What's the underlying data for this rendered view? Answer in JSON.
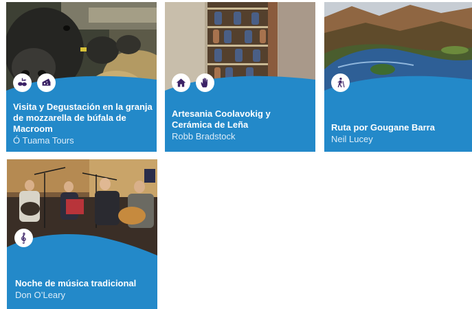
{
  "cards": [
    {
      "title": "Visita y Degustación en la granja de mozzarella de búfala de Macroom",
      "author": "Ó Tuama Tours",
      "icons": [
        "olives-icon",
        "cheese-icon"
      ]
    },
    {
      "title": "Artesania Coolavokig y Cerámica de Leña",
      "author": "Robb Bradstock",
      "icons": [
        "house-icon",
        "hand-icon"
      ]
    },
    {
      "title": "Ruta por Gougane Barra",
      "author": "Neil Lucey",
      "icons": [
        "hiker-icon"
      ]
    },
    {
      "title": "Noche de música tradicional",
      "author": "Don O’Leary",
      "icons": [
        "treble-clef-icon"
      ]
    }
  ],
  "colors": {
    "card_blue": "#2389c9",
    "icon_purple": "#3b2266",
    "text_white": "#ffffff"
  }
}
